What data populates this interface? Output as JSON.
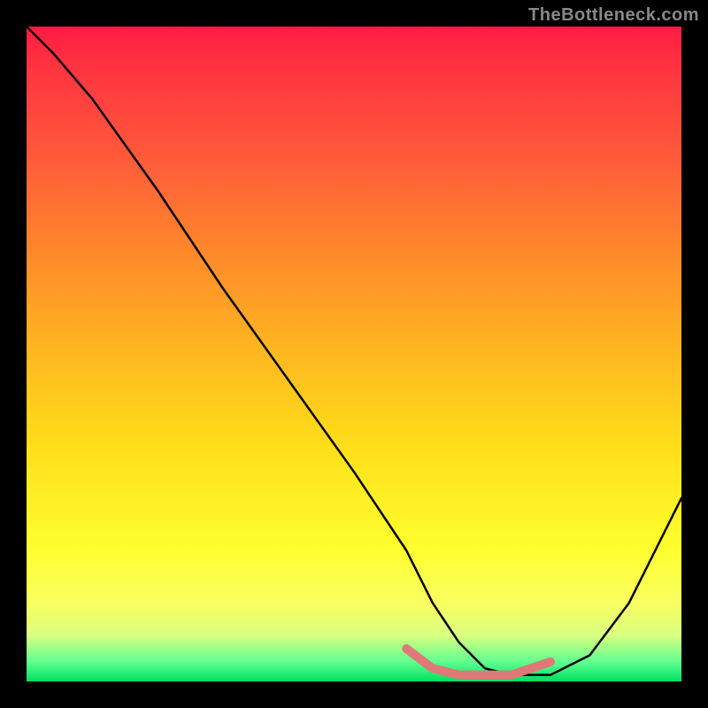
{
  "watermark": "TheBottleneck.com",
  "chart_data": {
    "type": "line",
    "title": "",
    "xlabel": "",
    "ylabel": "",
    "xlim": [
      0,
      100
    ],
    "ylim": [
      0,
      100
    ],
    "series": [
      {
        "name": "bottleneck-curve",
        "color": "#000000",
        "x": [
          0,
          4,
          10,
          20,
          30,
          40,
          50,
          58,
          62,
          66,
          70,
          74,
          80,
          86,
          92,
          100
        ],
        "values": [
          100,
          96,
          89,
          75,
          60,
          46,
          32,
          20,
          12,
          6,
          2,
          1,
          1,
          4,
          12,
          28
        ]
      },
      {
        "name": "optimal-range-highlight",
        "color": "#e07878",
        "x": [
          58,
          62,
          66,
          70,
          74,
          80
        ],
        "values": [
          5,
          2,
          1,
          1,
          1,
          3
        ]
      }
    ],
    "annotations": []
  }
}
